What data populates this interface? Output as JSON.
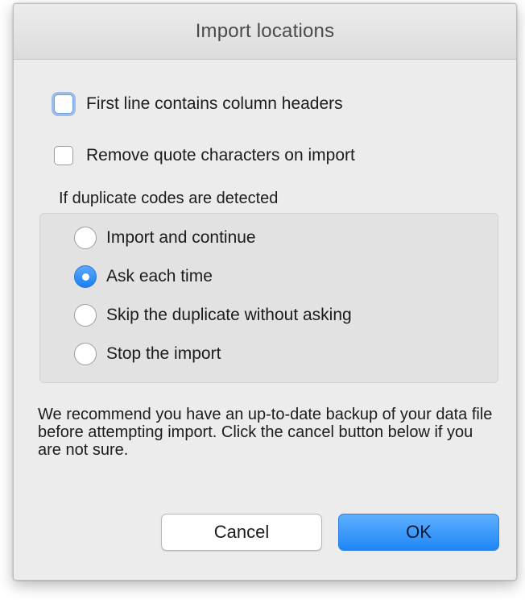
{
  "window": {
    "title": "Import locations"
  },
  "options": {
    "first_line_headers": {
      "label": "First line contains column headers",
      "checked": false,
      "focused": true
    },
    "remove_quotes": {
      "label": "Remove quote characters on import",
      "checked": false
    }
  },
  "duplicates": {
    "caption": "If duplicate codes are detected",
    "choices": [
      {
        "label": "Import and continue",
        "selected": false
      },
      {
        "label": "Ask each time",
        "selected": true
      },
      {
        "label": "Skip the duplicate without asking",
        "selected": false
      },
      {
        "label": "Stop the import",
        "selected": false
      }
    ]
  },
  "note": "We recommend you have an up-to-date backup of your data file before attempting import. Click the cancel button below if you are not sure.",
  "buttons": {
    "cancel": "Cancel",
    "ok": "OK"
  },
  "colors": {
    "accent": "#1f86f5",
    "window_bg": "#ececec"
  }
}
